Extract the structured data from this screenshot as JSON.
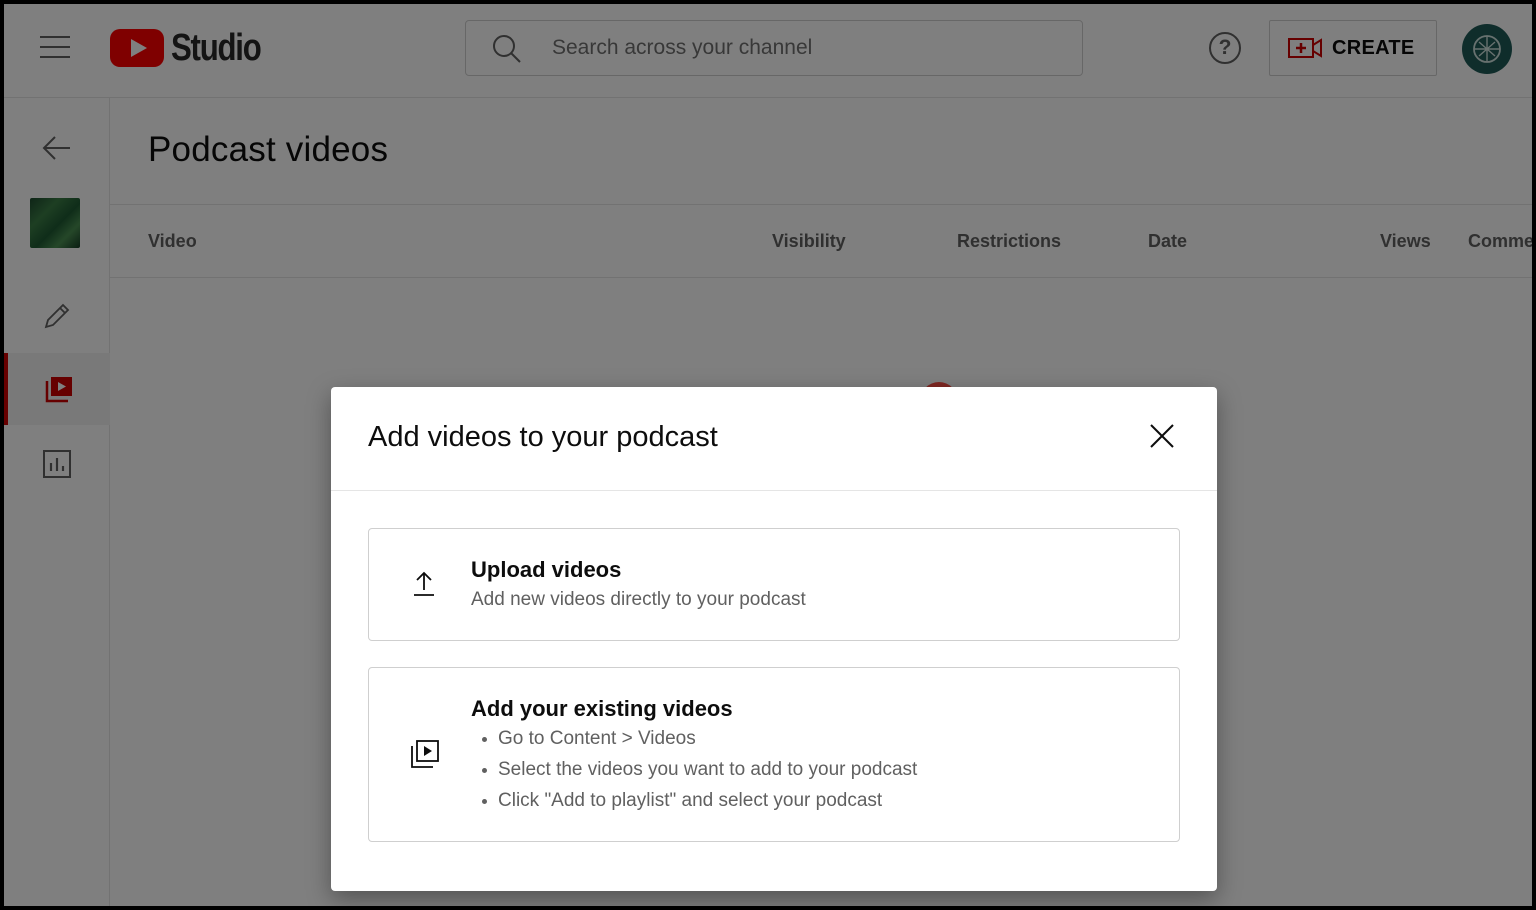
{
  "header": {
    "logo_text": "Studio",
    "search_placeholder": "Search across your channel",
    "help_label": "?",
    "create_label": "CREATE"
  },
  "page": {
    "title": "Podcast videos",
    "columns": [
      "Video",
      "Visibility",
      "Restrictions",
      "Date",
      "Views",
      "Comme"
    ]
  },
  "dialog": {
    "title": "Add videos to your podcast",
    "upload": {
      "title": "Upload videos",
      "description": "Add new videos directly to your podcast"
    },
    "existing": {
      "title": "Add your existing videos",
      "steps": [
        "Go to Content > Videos",
        "Select the videos you want to add to your podcast",
        "Click \"Add to playlist\" and select your podcast"
      ]
    }
  },
  "colors": {
    "brand_red": "#ff0000",
    "active_indicator": "#cc0000",
    "text_secondary": "#606060",
    "avatar_bg": "#1e5a57"
  },
  "icons": {
    "menu": "menu-icon",
    "search": "search-icon",
    "help": "help-icon",
    "create": "create-video-icon",
    "back": "back-arrow-icon",
    "edit": "pencil-icon",
    "content": "video-library-icon",
    "analytics": "analytics-icon",
    "close": "close-icon",
    "upload": "upload-icon",
    "existing": "video-library-icon"
  }
}
